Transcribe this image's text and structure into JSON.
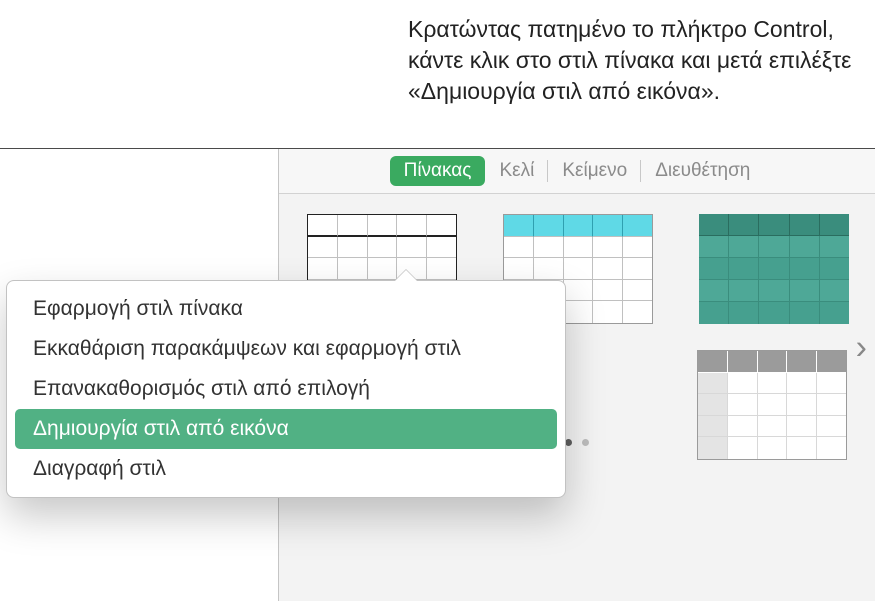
{
  "callout": "Κρατώντας πατημένο το πλήκτρο Control, κάντε κλικ στο στιλ πίνακα και μετά επιλέξτε «Δημιουργία στιλ από εικόνα».",
  "tabs": {
    "pinakas": "Πίνακας",
    "keli": "Κελί",
    "keimeno": "Κείμενο",
    "diefthetisi": "Διευθέτηση"
  },
  "thumbs": {
    "plain": "plain-table-style",
    "teal_header": "teal-header-table-style",
    "teal_full": "teal-fill-table-style",
    "gray": "gray-header-table-style"
  },
  "menu": {
    "apply": "Εφαρμογή στιλ πίνακα",
    "clear_overrides": "Εκκαθάριση παρακάμψεων και εφαρμογή στιλ",
    "redefine": "Επανακαθορισμός στιλ από επιλογή",
    "create_from_image": "Δημιουργία στιλ από εικόνα",
    "delete": "Διαγραφή στιλ"
  },
  "chevron_glyph": "›",
  "pager": {
    "count": 2,
    "active": 0
  }
}
